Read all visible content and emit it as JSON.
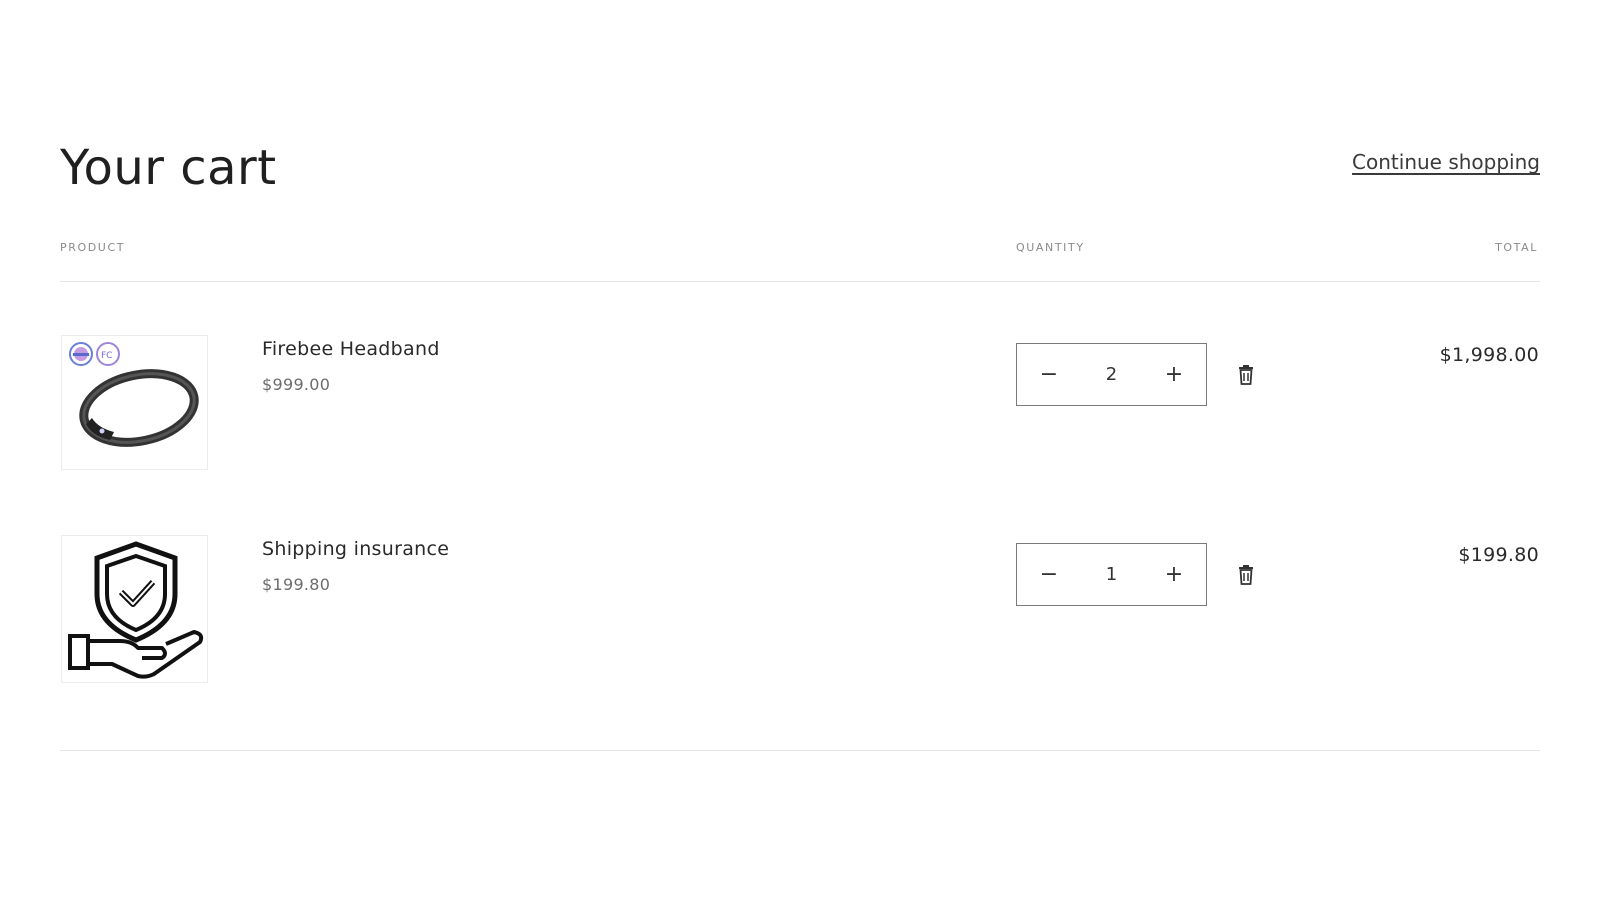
{
  "header": {
    "title": "Your cart",
    "continue_label": "Continue shopping"
  },
  "columns": {
    "product": "PRODUCT",
    "quantity": "QUANTITY",
    "total": "TOTAL"
  },
  "items": [
    {
      "name": "Firebee Headband",
      "unit_price": "$999.00",
      "quantity": "2",
      "line_total": "$1,998.00",
      "image_icon": "headband-product-image"
    },
    {
      "name": "Shipping insurance",
      "unit_price": "$199.80",
      "quantity": "1",
      "line_total": "$199.80",
      "image_icon": "shield-hand-icon"
    }
  ],
  "controls": {
    "minus": "−",
    "plus": "+"
  }
}
